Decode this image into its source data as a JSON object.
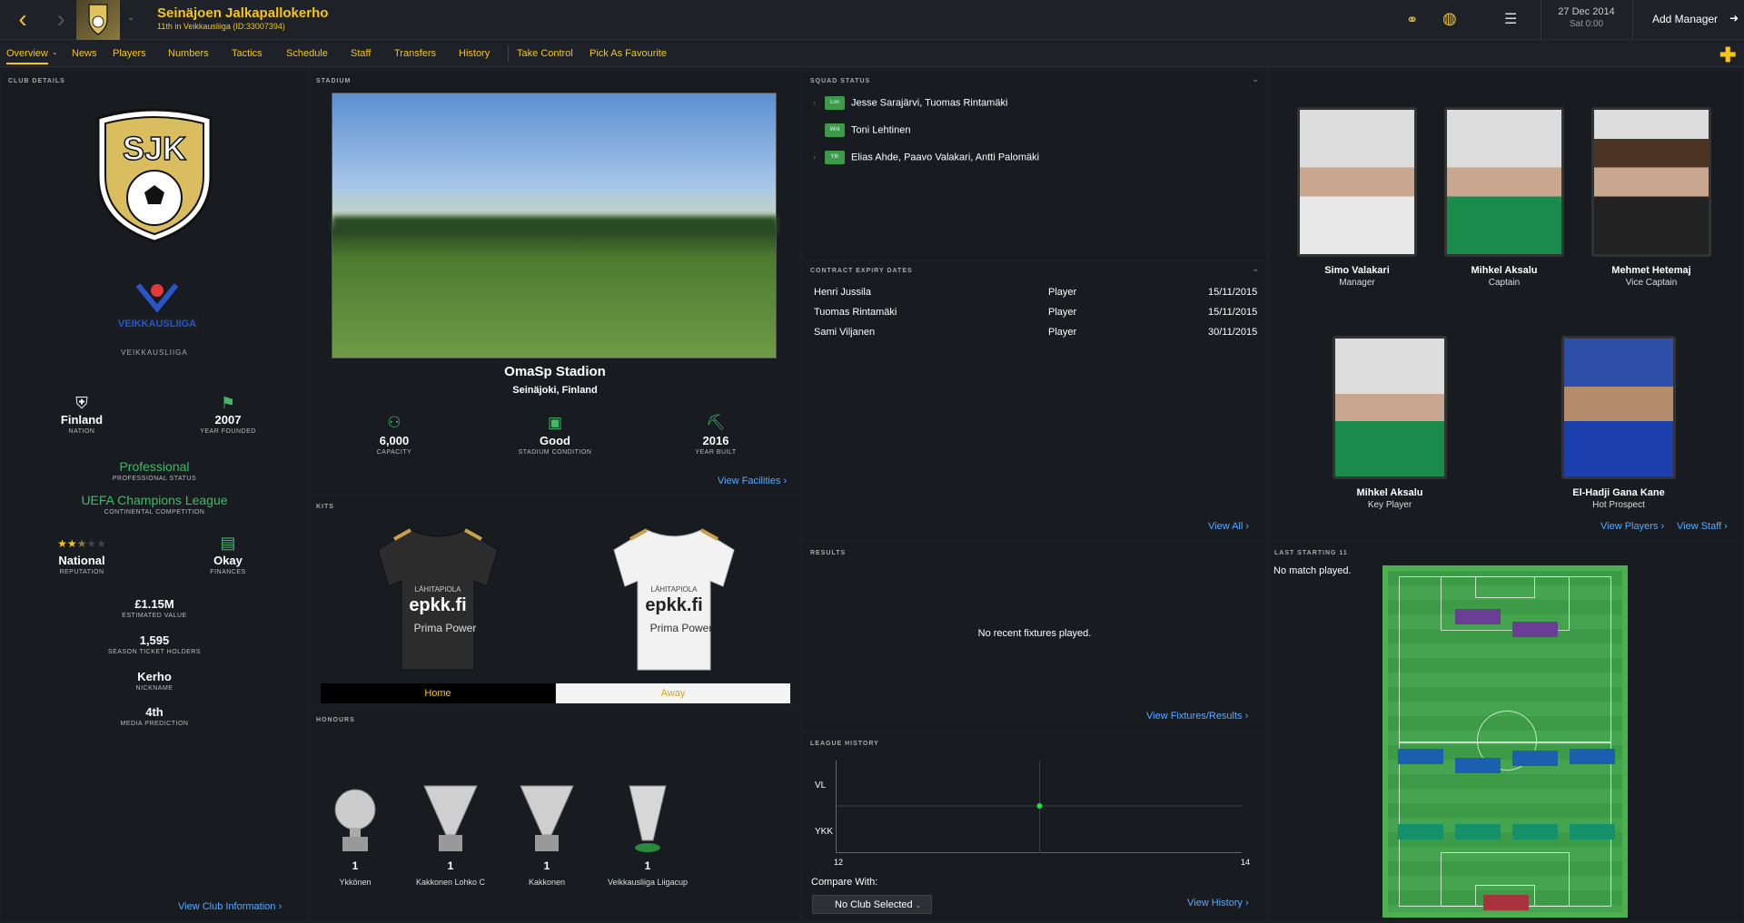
{
  "header": {
    "club_name": "Seinäjoen Jalkapallokerho",
    "club_subtitle": "11th in Veikkausliiga (ID:33007394)",
    "date": "27 Dec 2014",
    "day_time": "Sat 0:00",
    "add_manager": "Add Manager"
  },
  "menu": [
    "Overview",
    "News",
    "Players",
    "Numbers",
    "Tactics",
    "Schedule",
    "Staff",
    "Transfers",
    "History",
    "Take Control",
    "Pick As Favourite"
  ],
  "club_details": {
    "title": "CLUB DETAILS",
    "league": "VEIKKAUSLIIGA",
    "nation": "Finland",
    "nation_label": "NATION",
    "year_founded": "2007",
    "year_founded_label": "YEAR FOUNDED",
    "professional_status": "Professional",
    "professional_status_label": "PROFESSIONAL STATUS",
    "continental": "UEFA Champions League",
    "continental_label": "CONTINENTAL COMPETITION",
    "reputation": "National",
    "reputation_label": "REPUTATION",
    "reputation_stars": 2.5,
    "finances": "Okay",
    "finances_label": "FINANCES",
    "value": "£1.15M",
    "value_label": "ESTIMATED VALUE",
    "season_tickets": "1,595",
    "season_tickets_label": "SEASON TICKET HOLDERS",
    "nickname": "Kerho",
    "nickname_label": "NICKNAME",
    "media_prediction": "4th",
    "media_prediction_label": "MEDIA PREDICTION",
    "link": "View Club Information"
  },
  "stadium": {
    "title": "STADIUM",
    "name": "OmaSp Stadion",
    "location": "Seinäjoki, Finland",
    "capacity": "6,000",
    "capacity_label": "CAPACITY",
    "condition": "Good",
    "condition_label": "STADIUM CONDITION",
    "year_built": "2016",
    "year_built_label": "YEAR BUILT",
    "link": "View Facilities"
  },
  "kits": {
    "title": "KITS",
    "home": "Home",
    "away": "Away",
    "sponsor": "epkk.fi",
    "sponsor2": "LÄHITAPIOLA",
    "sponsor3": "Prima Power"
  },
  "honours": {
    "title": "HONOURS",
    "items": [
      {
        "count": "1",
        "name": "Ykkönen"
      },
      {
        "count": "1",
        "name": "Kakkonen Lohko C"
      },
      {
        "count": "1",
        "name": "Kakkonen"
      },
      {
        "count": "1",
        "name": "Veikkausliiga Liigacup"
      }
    ]
  },
  "squad_status": {
    "title": "SQUAD STATUS",
    "rows": [
      {
        "badge": "Lon",
        "names": "Jesse Sarajärvi, Tuomas Rintamäki"
      },
      {
        "badge": "Wnt",
        "names": "Toni Lehtinen"
      },
      {
        "badge": "Yth",
        "names": "Elias Ahde, Paavo Valakari, Antti Palomäki"
      }
    ]
  },
  "contracts": {
    "title": "CONTRACT EXPIRY DATES",
    "rows": [
      {
        "name": "Henri Jussila",
        "role": "Player",
        "date": "15/11/2015"
      },
      {
        "name": "Tuomas Rintamäki",
        "role": "Player",
        "date": "15/11/2015"
      },
      {
        "name": "Sami Viljanen",
        "role": "Player",
        "date": "30/11/2015"
      }
    ],
    "link": "View All"
  },
  "people": [
    {
      "name": "Simo Valakari",
      "role": "Manager"
    },
    {
      "name": "Mihkel Aksalu",
      "role": "Captain"
    },
    {
      "name": "Mehmet Hetemaj",
      "role": "Vice Captain"
    },
    {
      "name": "Mihkel Aksalu",
      "role": "Key Player"
    },
    {
      "name": "El-Hadji Gana Kane",
      "role": "Hot Prospect"
    }
  ],
  "people_links": {
    "players": "View Players",
    "staff": "View Staff"
  },
  "results": {
    "title": "RESULTS",
    "empty": "No recent fixtures played.",
    "link": "View Fixtures/Results"
  },
  "league_history": {
    "title": "LEAGUE HISTORY",
    "compare_label": "Compare With:",
    "compare_value": "No Club Selected",
    "link": "View History",
    "chart_data": {
      "type": "line",
      "x": [
        13
      ],
      "y": [
        "VL"
      ],
      "xlim": [
        12,
        14
      ],
      "x_ticks": [
        "12",
        "14"
      ],
      "y_ticks": [
        "VL",
        "YKK"
      ]
    }
  },
  "last_xi": {
    "title": "LAST STARTING 11",
    "empty": "No match played."
  }
}
